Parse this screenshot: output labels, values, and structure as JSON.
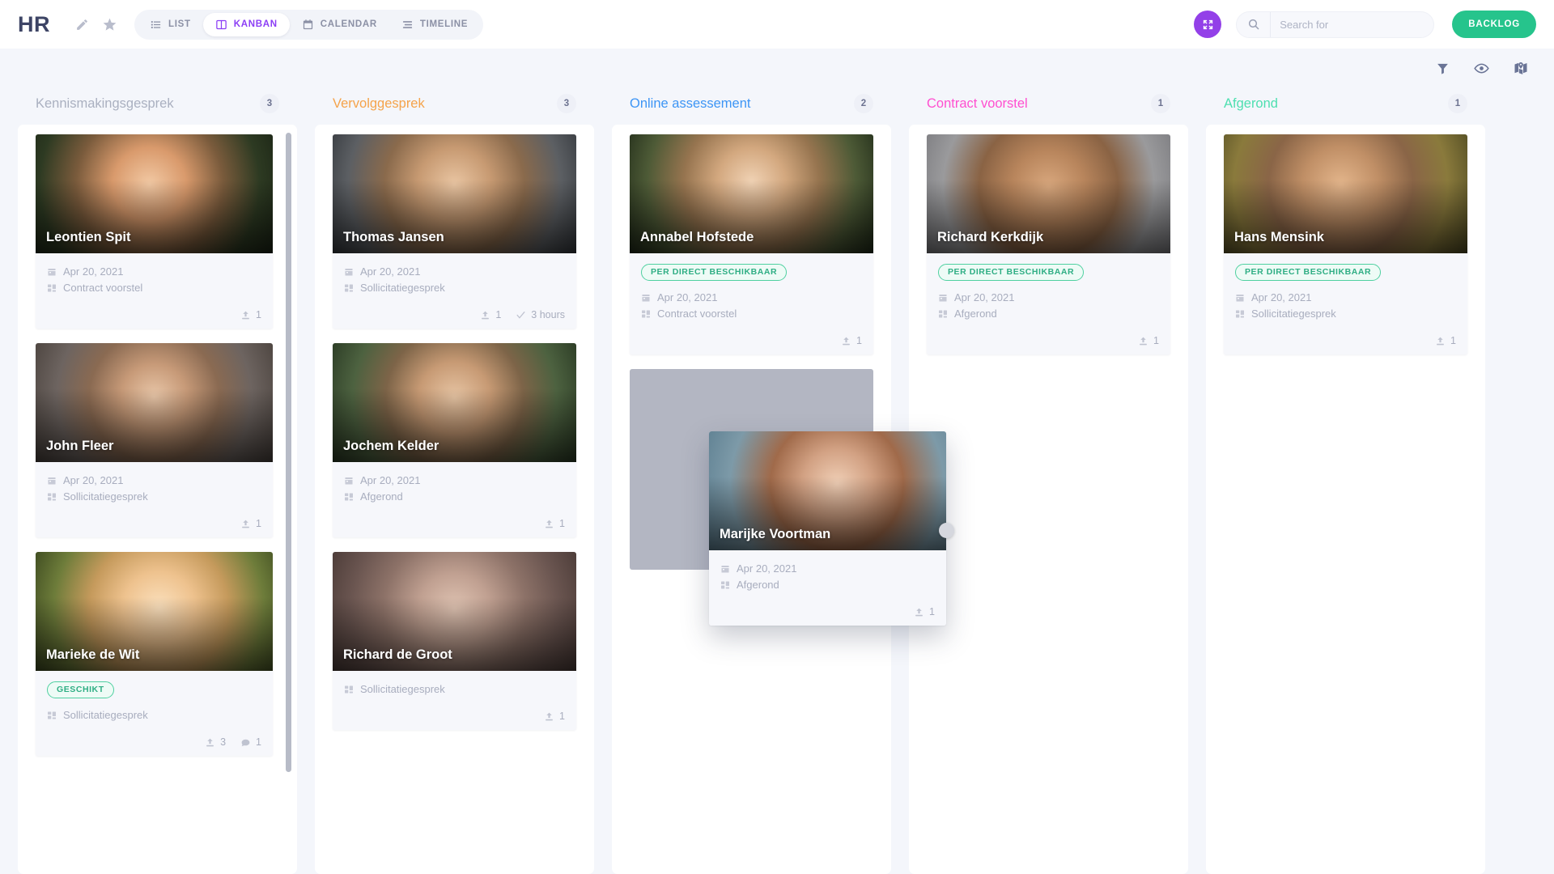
{
  "header": {
    "app_title": "HR",
    "edit_icon": "pencil-icon",
    "favorite_icon": "star-icon",
    "view_tabs": [
      {
        "label": "LIST",
        "icon": "list-icon",
        "active": false
      },
      {
        "label": "KANBAN",
        "icon": "kanban-icon",
        "active": true
      },
      {
        "label": "CALENDAR",
        "icon": "calendar-icon",
        "active": false
      },
      {
        "label": "TIMELINE",
        "icon": "timeline-icon",
        "active": false
      }
    ],
    "expand_button_icon": "expand-arrows-icon",
    "search": {
      "placeholder": "Search for",
      "value": "",
      "icon": "search-icon"
    },
    "backlog_label": "BACKLOG"
  },
  "toolbar": {
    "items": [
      {
        "icon": "filter-icon"
      },
      {
        "icon": "eye-icon"
      },
      {
        "icon": "map-icon"
      }
    ]
  },
  "colors": {
    "accent_purple": "#8b3df5",
    "backlog_green": "#26c48c",
    "tag_green": "#2fae84",
    "column_gray": "#aab0c0",
    "column_orange": "#f5a34a",
    "column_blue": "#3d95f5",
    "column_pink": "#ff4fd0",
    "column_teal": "#4ddfb0"
  },
  "board": {
    "columns": [
      {
        "title": "Kennismakingsgesprek",
        "count": "3",
        "color": "#aab0c0",
        "has_scrollbar": true,
        "cards": [
          {
            "name": "Leontien Spit",
            "photo": "ph-leontien",
            "tag": null,
            "date": "Apr 20, 2021",
            "board": "Contract voorstel",
            "uploads": "1",
            "comments": null,
            "time": null
          },
          {
            "name": "John Fleer",
            "photo": "ph-john",
            "tag": null,
            "date": "Apr 20, 2021",
            "board": "Sollicitatiegesprek",
            "uploads": "1",
            "comments": null,
            "time": null
          },
          {
            "name": "Marieke de Wit",
            "photo": "ph-marieke",
            "tag": "GESCHIKT",
            "date": null,
            "board": "Sollicitatiegesprek",
            "uploads": "3",
            "comments": "1",
            "time": null
          }
        ]
      },
      {
        "title": "Vervolggesprek",
        "count": "3",
        "color": "#f5a34a",
        "has_scrollbar": false,
        "cards": [
          {
            "name": "Thomas Jansen",
            "photo": "ph-thomas",
            "tag": null,
            "date": "Apr 20, 2021",
            "board": "Sollicitatiegesprek",
            "uploads": "1",
            "comments": null,
            "time": "3 hours"
          },
          {
            "name": "Jochem Kelder",
            "photo": "ph-jochem",
            "tag": null,
            "date": "Apr 20, 2021",
            "board": "Afgerond",
            "uploads": "1",
            "comments": null,
            "time": null
          },
          {
            "name": "Richard de Groot",
            "photo": "ph-rgroot",
            "tag": null,
            "date": null,
            "board": "Sollicitatiegesprek",
            "uploads": "1",
            "comments": null,
            "time": null
          }
        ]
      },
      {
        "title": "Online assessement",
        "count": "2",
        "color": "#3d95f5",
        "has_scrollbar": false,
        "has_placeholder": true,
        "cards": [
          {
            "name": "Annabel Hofstede",
            "photo": "ph-annabel",
            "tag": "PER DIRECT BESCHIKBAAR",
            "date": "Apr 20, 2021",
            "board": "Contract voorstel",
            "uploads": "1",
            "comments": null,
            "time": null
          }
        ]
      },
      {
        "title": "Contract voorstel",
        "count": "1",
        "color": "#ff4fd0",
        "has_scrollbar": false,
        "cards": [
          {
            "name": "Richard Kerkdijk",
            "photo": "ph-richardk",
            "tag": "PER DIRECT BESCHIKBAAR",
            "date": "Apr 20, 2021",
            "board": "Afgerond",
            "uploads": "1",
            "comments": null,
            "time": null
          }
        ]
      },
      {
        "title": "Afgerond",
        "count": "1",
        "color": "#4ddfb0",
        "has_scrollbar": false,
        "cards": [
          {
            "name": "Hans Mensink",
            "photo": "ph-hans",
            "tag": "PER DIRECT BESCHIKBAAR",
            "date": "Apr 20, 2021",
            "board": "Sollicitatiegesprek",
            "uploads": "1",
            "comments": null,
            "time": null
          }
        ]
      }
    ]
  },
  "dragged_card": {
    "name": "Marijke Voortman",
    "photo": "ph-marijke",
    "tag": null,
    "date": "Apr 20, 2021",
    "board": "Afgerond",
    "uploads": "1",
    "comments": null,
    "time": null
  }
}
